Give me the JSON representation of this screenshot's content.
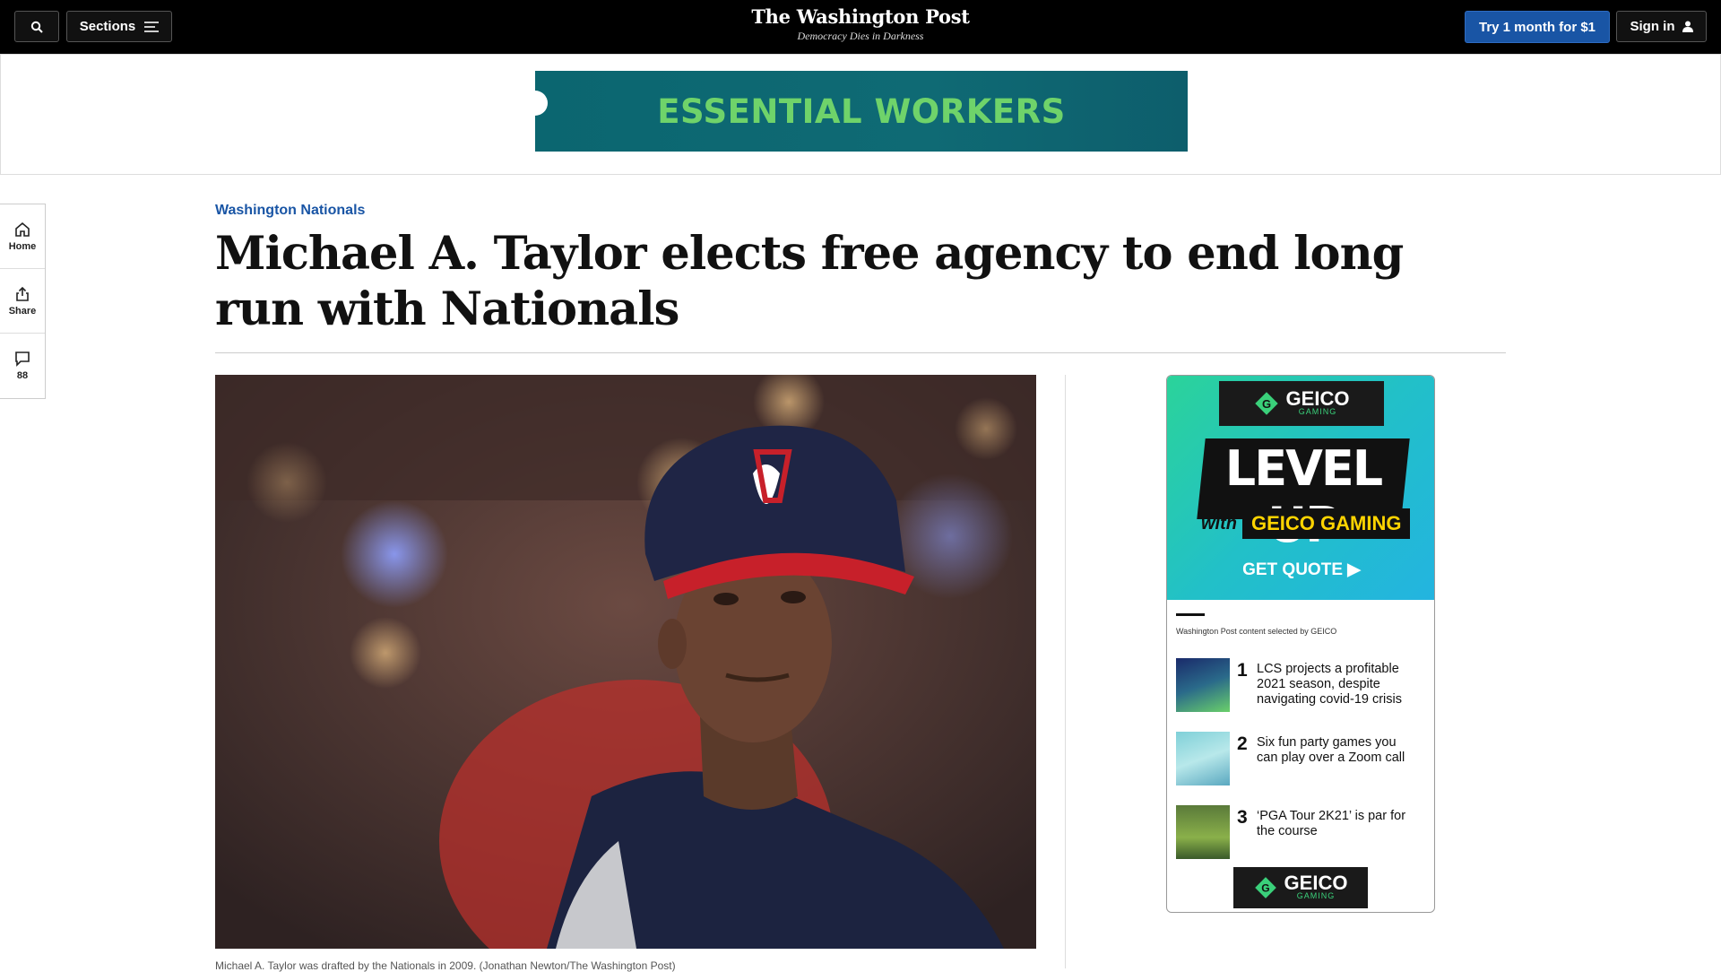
{
  "header": {
    "sections_label": "Sections",
    "brand_name": "The Washington Post",
    "brand_tagline": "Democracy Dies in Darkness",
    "subscribe_label": "Try 1 month for $1",
    "signin_label": "Sign in"
  },
  "top_ad": {
    "text": "ESSENTIAL WORKERS",
    "text_color": "#6fd36a",
    "background": "#0b6670"
  },
  "left_rail": {
    "home_label": "Home",
    "share_label": "Share",
    "comments_count": "88"
  },
  "article": {
    "kicker": "Washington Nationals",
    "headline": "Michael A. Taylor elects free agency to end long run with Nationals",
    "caption": "Michael A. Taylor was drafted by the Nationals in 2009. (Jonathan Newton/The Washington Post)"
  },
  "side_ad": {
    "logo_word": "GEICO",
    "logo_sub": "GAMING",
    "headline": "LEVEL UP",
    "with": "with",
    "brand_line": "GEICO GAMING",
    "cta": "GET QUOTE ▶",
    "note": "Washington Post content selected by GEICO",
    "items": [
      {
        "num": "1",
        "title": "LCS projects a profitable 2021 season, despite navigating covid-19 crisis"
      },
      {
        "num": "2",
        "title": "Six fun party games you can play over a Zoom call"
      },
      {
        "num": "3",
        "title": "‘PGA Tour 2K21’ is par for the course"
      }
    ]
  },
  "colors": {
    "accent_blue": "#1955a5",
    "topbar": "#000000"
  }
}
